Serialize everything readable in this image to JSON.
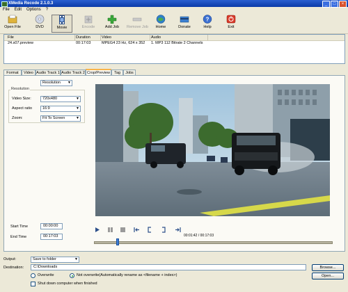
{
  "window": {
    "title": "XMedia Recode 2.1.0.3"
  },
  "menu": [
    "File",
    "Edit",
    "Options",
    "?"
  ],
  "toolbar": [
    {
      "label": "Open File",
      "icon": "open-file-icon"
    },
    {
      "label": "DVD",
      "icon": "dvd-icon"
    },
    {
      "label": "Movie",
      "icon": "movie-icon"
    },
    {
      "label": "Encode",
      "icon": "encode-icon"
    },
    {
      "label": "Add Job",
      "icon": "add-job-icon"
    },
    {
      "label": "Remove Job",
      "icon": "remove-job-icon"
    },
    {
      "label": "Home",
      "icon": "home-icon"
    },
    {
      "label": "Donate",
      "icon": "donate-icon"
    },
    {
      "label": "Help",
      "icon": "help-icon"
    },
    {
      "label": "Exit",
      "icon": "exit-icon"
    }
  ],
  "filelist": {
    "columns": [
      "File",
      "Duration",
      "Video",
      "Audio"
    ],
    "rows": [
      {
        "file": "24.s07.preview",
        "duration": "00:17:03",
        "video": "MPEG4 23 Hz, 624 x 352",
        "audio": "1. MP3 112 Bitrate 2 Channels"
      }
    ]
  },
  "tabs": [
    "Format",
    "Video",
    "Audio Track 1",
    "Audio Track 2",
    "Crop/Preview",
    "Tag",
    "Jobs"
  ],
  "active_tab": "Crop/Preview",
  "crop": {
    "mode": "Resolution",
    "group_label": "Resolution",
    "video_size_label": "Video Size:",
    "video_size": "720x480",
    "aspect_label": "Aspect ratio",
    "aspect": "16:9",
    "zoom_label": "Zoom:",
    "zoom": "Fit To Screen",
    "start_label": "Start Time",
    "start_time": "00:00:00",
    "end_label": "End Time",
    "end_time": "00:17:03",
    "timecode": "00:01:42 / 00:17:03",
    "position_fraction": 0.1
  },
  "output": {
    "output_label": "Output:",
    "output_mode": "Save to folder",
    "destination_label": "Destination:",
    "destination": "C:\\Downloads",
    "browse": "Browse...",
    "open": "Open...",
    "overwrite": "Overwrite",
    "not_overwrite": "Not overwrite(Automatically rename as <filename + index>)",
    "shutdown": "Shut down computer when finished"
  }
}
